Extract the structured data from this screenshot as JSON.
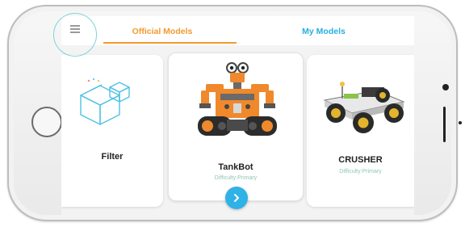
{
  "header": {
    "tabs": [
      {
        "label": "Official Models",
        "active": true
      },
      {
        "label": "My Models",
        "active": false
      }
    ],
    "active_color": "#f39a2f",
    "inactive_color": "#29aee0"
  },
  "menu": {
    "icon": "hamburger-menu-icon"
  },
  "cards": [
    {
      "name": "Filter",
      "difficulty": "",
      "icon": "cube-filter-icon"
    },
    {
      "name": "TankBot",
      "difficulty": "Difficulty:Primary",
      "icon": "tankbot-robot-image"
    },
    {
      "name": "CRUSHER",
      "difficulty": "Difficulty:Primary",
      "icon": "crusher-car-image"
    }
  ],
  "next_button": {
    "icon": "chevron-right-icon",
    "color": "#2fb2e6"
  }
}
